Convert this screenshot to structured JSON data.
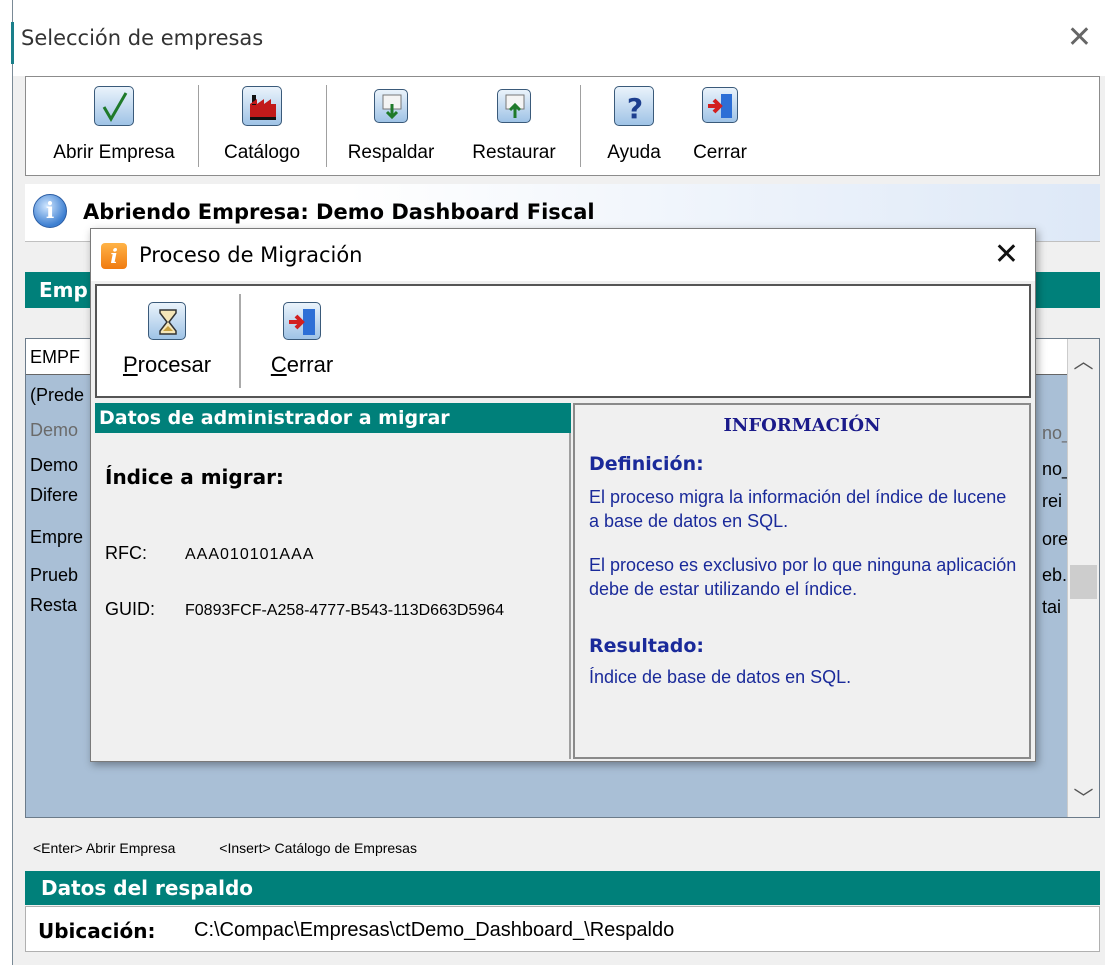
{
  "main_window": {
    "title": "Selección de empresas",
    "close_glyph": "✕"
  },
  "toolbar": {
    "items": [
      {
        "label": "Abrir Empresa",
        "icon": "checkmark-icon"
      },
      {
        "label": "Catálogo",
        "icon": "factory-icon"
      },
      {
        "label": "Respaldar",
        "icon": "backup-icon"
      },
      {
        "label": "Restaurar",
        "icon": "restore-icon"
      },
      {
        "label": "Ayuda",
        "icon": "help-icon"
      },
      {
        "label": "Cerrar",
        "icon": "exit-icon"
      }
    ]
  },
  "banner": {
    "text": "Abriendo Empresa: Demo Dashboard Fiscal",
    "icon": "info-icon"
  },
  "empresas": {
    "header_partial": "Emp",
    "column_header_partial": "EMPF",
    "rows_left": [
      "(Prede",
      "Demo",
      "Demo",
      "Difere",
      "Empre",
      "Prueb",
      "Resta"
    ],
    "rows_right": [
      "no_",
      "no_",
      "rei",
      "ore",
      "eb.",
      "tai"
    ]
  },
  "shortcuts": {
    "enter": "<Enter> Abrir Empresa",
    "insert": "<Insert> Catálogo de Empresas"
  },
  "respaldo": {
    "header": "Datos del respaldo",
    "label": "Ubicación:",
    "value": "C:\\Compac\\Empresas\\ctDemo_Dashboard_\\Respaldo"
  },
  "dialog": {
    "title": "Proceso de Migración",
    "icon": "app-info-icon",
    "close_glyph": "✕",
    "buttons": [
      {
        "accel": "P",
        "rest": "rocesar",
        "icon": "hourglass-icon"
      },
      {
        "accel": "C",
        "rest": "errar",
        "icon": "exit-icon"
      }
    ],
    "left": {
      "header": "Datos de administrador a migrar",
      "index_label": "Índice a migrar:",
      "rfc_label": "RFC:",
      "rfc_value": "AAA010101AAA",
      "guid_label": "GUID:",
      "guid_value": "F0893FCF-A258-4777-B543-113D663D5964"
    },
    "right": {
      "title": "INFORMACIÓN",
      "definition_head": "Definición:",
      "definition_text1": "El proceso migra la información del índice de lucene a base de datos en SQL.",
      "definition_text2": "El proceso es exclusivo por lo que ninguna aplicación debe de estar utilizando el índice.",
      "result_head": "Resultado:",
      "result_text": "Índice de base de datos en SQL."
    }
  },
  "colors": {
    "section_header": "#00807a",
    "info_text": "#1a2a9a",
    "list_background": "#a9bfd6"
  }
}
